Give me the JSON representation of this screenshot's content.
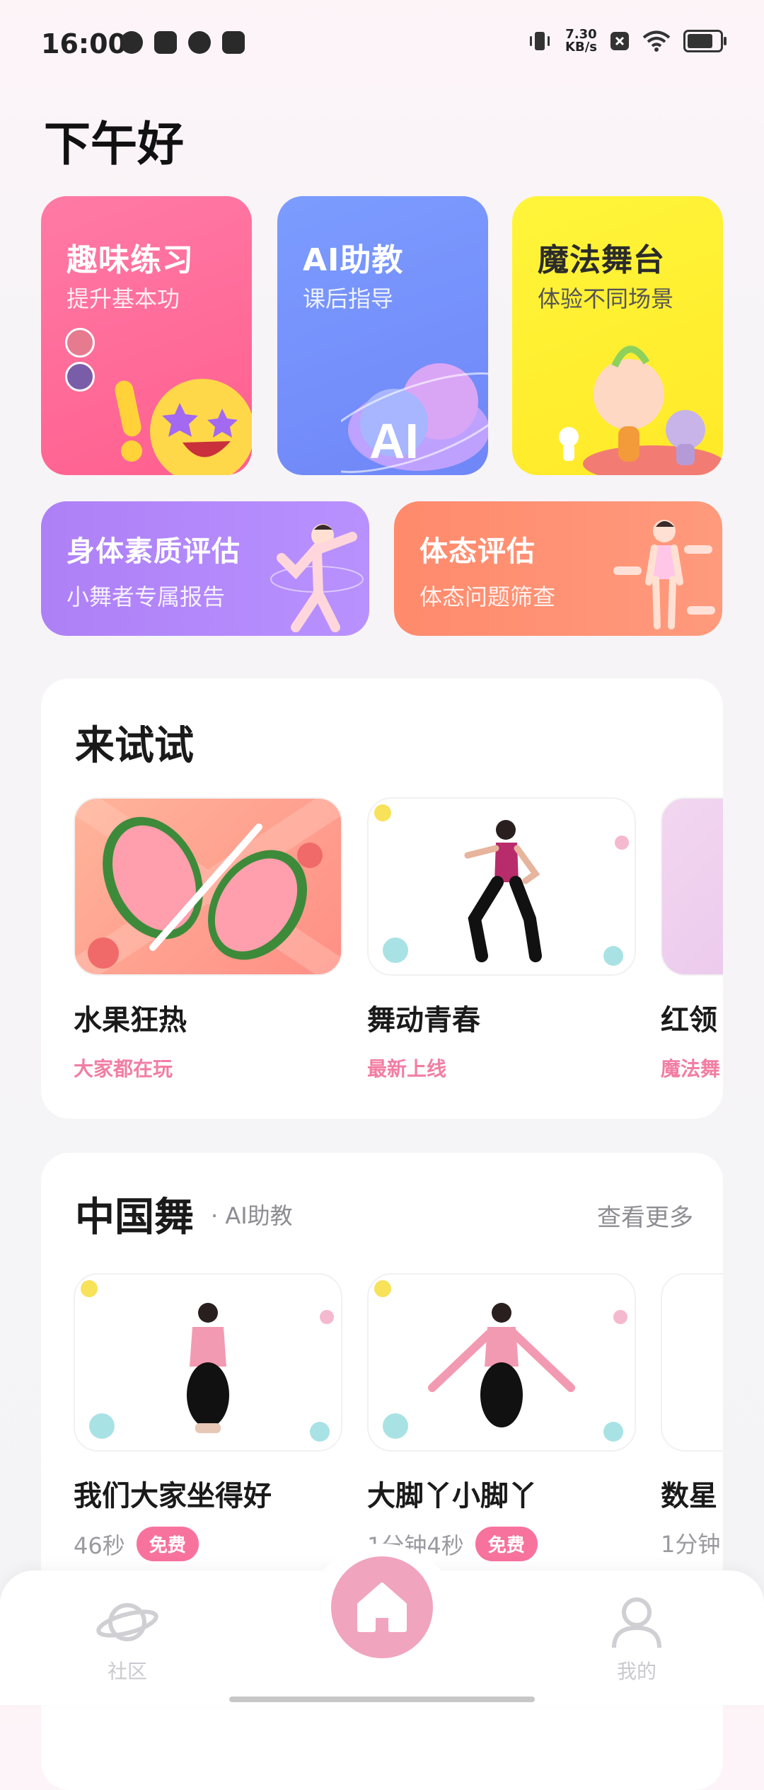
{
  "status_bar": {
    "time": "16:00",
    "net_speed_value": "7.30",
    "net_speed_unit": "KB/s"
  },
  "greeting": "下午好",
  "feature_cards": [
    {
      "title": "趣味练习",
      "subtitle": "提升基本功"
    },
    {
      "title": "AI助教",
      "subtitle": "课后指导"
    },
    {
      "title": "魔法舞台",
      "subtitle": "体验不同场景"
    },
    {
      "title": "身体素质评估",
      "subtitle": "小舞者专属报告"
    },
    {
      "title": "体态评估",
      "subtitle": "体态问题筛查"
    }
  ],
  "try_section": {
    "title": "来试试",
    "items": [
      {
        "name": "水果狂热",
        "tag": "大家都在玩"
      },
      {
        "name": "舞动青春",
        "tag": "最新上线"
      },
      {
        "name": "红领",
        "tag": "魔法舞"
      }
    ]
  },
  "dance_section": {
    "title": "中国舞",
    "subtitle": "· AI助教",
    "more": "查看更多",
    "items": [
      {
        "name": "我们大家坐得好",
        "duration": "46秒",
        "badge": "免费"
      },
      {
        "name": "大脚丫小脚丫",
        "duration": "1分钟4秒",
        "badge": "免费"
      },
      {
        "name": "数星",
        "duration": "1分钟",
        "badge": ""
      }
    ]
  },
  "bottom_nav": {
    "community": "社区",
    "mine": "我的"
  },
  "colors": {
    "accent_pink": "#f7739e",
    "home_button": "#f0a4be"
  },
  "icons": [
    "vibrate-icon",
    "close-box-icon",
    "wifi-icon",
    "battery-icon",
    "planet-icon",
    "home-icon",
    "person-icon"
  ]
}
